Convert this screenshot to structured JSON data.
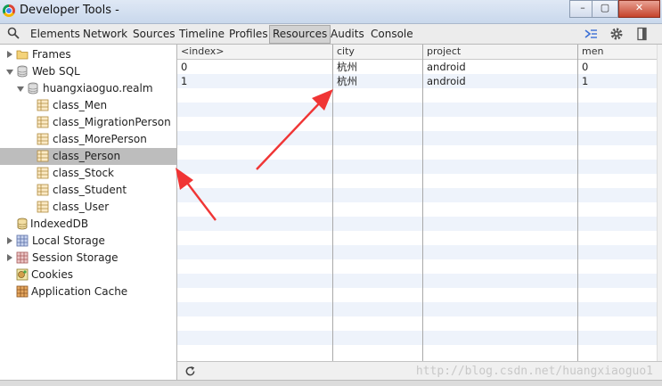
{
  "window": {
    "title": "Developer Tools -",
    "minimize": "–",
    "maximize": "▢",
    "close": "✕"
  },
  "toolbar": {
    "tabs": [
      "Elements",
      "Network",
      "Sources",
      "Timeline",
      "Profiles",
      "Resources",
      "Audits",
      "Console"
    ],
    "selected_tab": "Resources",
    "icons": [
      "search-icon",
      "console-drawer-icon",
      "gear-icon",
      "dock-icon"
    ]
  },
  "sidebar": {
    "items": [
      {
        "label": "Frames",
        "icon": "folder-icon",
        "expanded": false
      },
      {
        "label": "Web SQL",
        "icon": "database-icon",
        "expanded": true
      },
      {
        "label": "huangxiaoguo.realm",
        "icon": "database-icon",
        "expanded": true
      },
      {
        "label": "class_Men",
        "icon": "table-icon"
      },
      {
        "label": "class_MigrationPerson",
        "icon": "table-icon"
      },
      {
        "label": "class_MorePerson",
        "icon": "table-icon"
      },
      {
        "label": "class_Person",
        "icon": "table-icon",
        "selected": true
      },
      {
        "label": "class_Stock",
        "icon": "table-icon"
      },
      {
        "label": "class_Student",
        "icon": "table-icon"
      },
      {
        "label": "class_User",
        "icon": "table-icon"
      },
      {
        "label": "IndexedDB",
        "icon": "database-icon"
      },
      {
        "label": "Local Storage",
        "icon": "storage-grid-icon",
        "expanded": false
      },
      {
        "label": "Session Storage",
        "icon": "storage-grid-icon",
        "expanded": false
      },
      {
        "label": "Cookies",
        "icon": "cookie-icon"
      },
      {
        "label": "Application Cache",
        "icon": "appcache-icon"
      }
    ]
  },
  "table": {
    "columns": [
      "<index>",
      "city",
      "project",
      "men"
    ],
    "rows": [
      [
        "0",
        "杭州",
        "android",
        "0"
      ],
      [
        "1",
        "杭州",
        "android",
        "1"
      ]
    ]
  },
  "statusbar": {
    "icon": "refresh-icon",
    "watermark": "http://blog.csdn.net/huangxiaoguo1"
  },
  "annotations": {
    "arrow_color": "#f03535"
  }
}
